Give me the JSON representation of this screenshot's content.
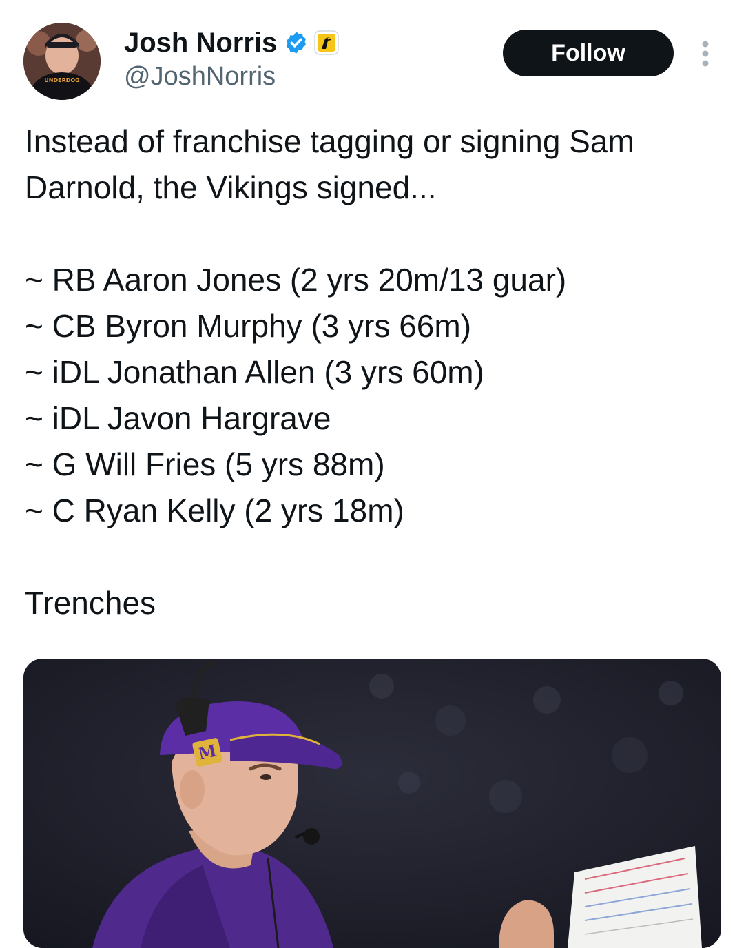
{
  "tweet": {
    "author": {
      "display_name": "Josh Norris",
      "handle": "@JoshNorris",
      "avatar_shirt_text": "UNDERDOG",
      "verified_color": "#1d9bf0"
    },
    "follow_label": "Follow",
    "text": {
      "intro_line1": "Instead of franchise tagging or signing Sam",
      "intro_line2": "Darnold, the Vikings signed...",
      "signings": [
        "~ RB Aaron Jones (2 yrs 20m/13 guar)",
        "~ CB Byron Murphy (3 yrs 66m)",
        "~ iDL Jonathan Allen (3 yrs 60m)",
        "~ iDL Javon Hargrave",
        "~ G Will Fries (5 yrs 88m)",
        "~ C Ryan Kelly (2 yrs 18m)"
      ],
      "closing": "Trenches"
    },
    "media": {
      "description_icon": "photo-coach-headset"
    }
  },
  "colors": {
    "text": "#0f1419",
    "secondary": "#536471",
    "button_bg": "#0f1419",
    "badge_yellow": "#f5c518"
  }
}
